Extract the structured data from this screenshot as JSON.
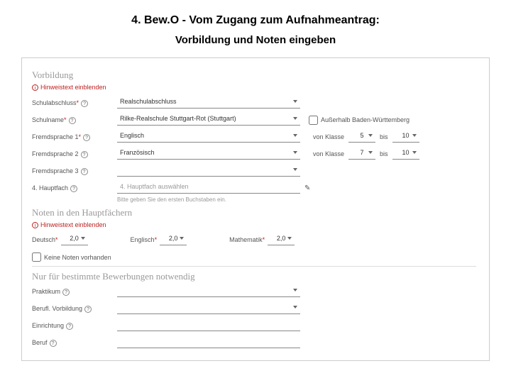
{
  "title": "4. Bew.O - Vom Zugang zum Aufnahmeantrag:",
  "subtitle": "Vorbildung und Noten eingeben",
  "sections": {
    "vorbildung": {
      "heading": "Vorbildung",
      "hint": "Hinweistext einblenden"
    },
    "noten": {
      "heading": "Noten in den Hauptfächern",
      "hint": "Hinweistext einblenden"
    },
    "weitere": {
      "heading": "Nur für bestimmte Bewerbungen notwendig"
    }
  },
  "labels": {
    "schulabschluss": "Schulabschluss",
    "schulname": "Schulname",
    "fremdsprache1": "Fremdsprache 1",
    "fremdsprache2": "Fremdsprache 2",
    "fremdsprache3": "Fremdsprache 3",
    "hauptfach4": "4. Hauptfach",
    "ausserhalb": "Außerhalb Baden-Württemberg",
    "vonKlasse": "von Klasse",
    "bis": "bis",
    "deutsch": "Deutsch",
    "englisch": "Englisch",
    "mathematik": "Mathematik",
    "keineNoten": "Keine Noten vorhanden",
    "praktikum": "Praktikum",
    "beruflVorbildung": "Berufl. Vorbildung",
    "einrichtung": "Einrichtung",
    "beruf": "Beruf"
  },
  "values": {
    "schulabschluss": "Realschulabschluss",
    "schulname": "Rilke-Realschule Stuttgart-Rot (Stuttgart)",
    "fremdsprache1": "Englisch",
    "fs1_von": "5",
    "fs1_bis": "10",
    "fremdsprache2": "Französisch",
    "fs2_von": "7",
    "fs2_bis": "10",
    "hauptfach4_placeholder": "4. Hauptfach auswählen",
    "hauptfach_hint": "Bitte geben Sie den ersten Buchstaben ein.",
    "note_deutsch": "2,0",
    "note_englisch": "2,0",
    "note_mathe": "2,0"
  }
}
